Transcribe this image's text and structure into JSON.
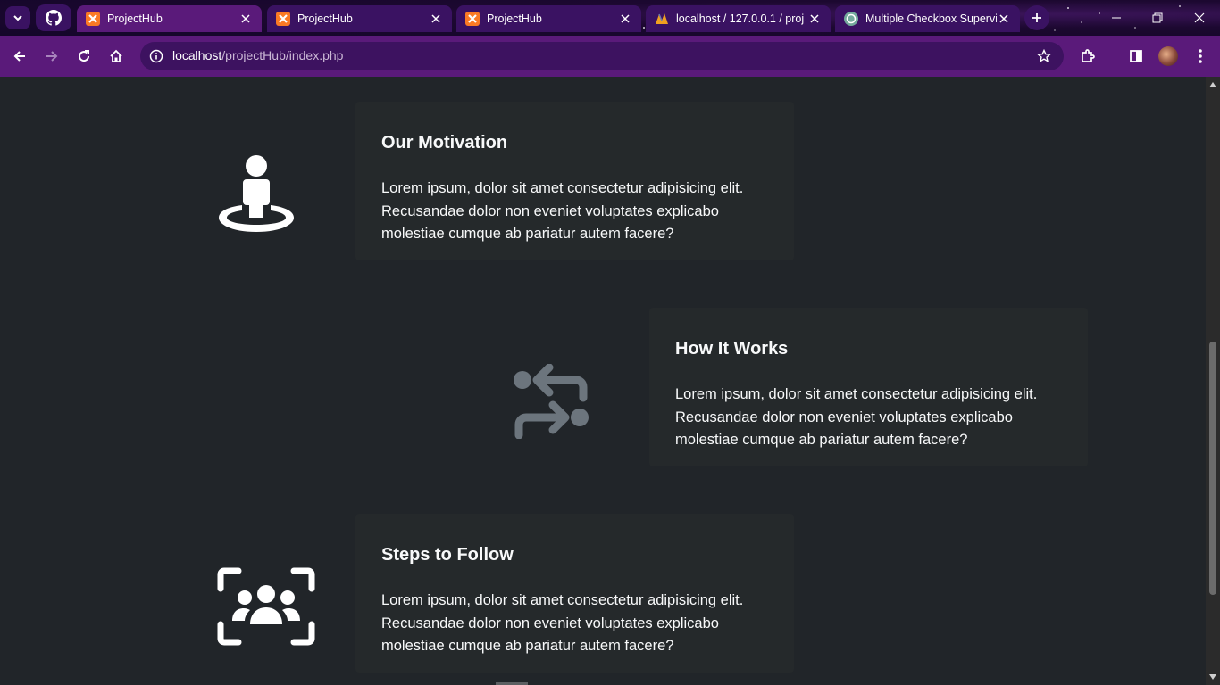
{
  "browser": {
    "tabs": [
      {
        "title": "ProjectHub",
        "favicon": "xampp-icon",
        "active": true
      },
      {
        "title": "ProjectHub",
        "favicon": "xampp-icon",
        "active": false
      },
      {
        "title": "ProjectHub",
        "favicon": "xampp-icon",
        "active": false
      },
      {
        "title": "localhost / 127.0.0.1 / proj",
        "favicon": "phpmyadmin-icon",
        "active": false
      },
      {
        "title": "Multiple Checkbox Supervi",
        "favicon": "chatgpt-icon",
        "active": false
      }
    ],
    "url_host": "localhost",
    "url_path": "/projectHub/index.php",
    "accent": "#5a1a7a"
  },
  "sections": [
    {
      "title": "Our Motivation",
      "text": "Lorem ipsum, dolor sit amet consectetur adipisicing elit. Recusandae dolor non eveniet voluptates explicabo molestiae cumque ab pariatur autem facere?",
      "icon": "person-standing-icon",
      "icon_color": "#ffffff"
    },
    {
      "title": "How It Works",
      "text": "Lorem ipsum, dolor sit amet consectetur adipisicing elit. Recusandae dolor non eveniet voluptates explicabo molestiae cumque ab pariatur autem facere?",
      "icon": "arrows-exchange-icon",
      "icon_color": "#6c757d"
    },
    {
      "title": "Steps to Follow",
      "text": "Lorem ipsum, dolor sit amet consectetur adipisicing elit. Recusandae dolor non eveniet voluptates explicabo molestiae cumque ab pariatur autem facere?",
      "icon": "group-focus-icon",
      "icon_color": "#ffffff"
    }
  ],
  "colors": {
    "page_bg": "#212529",
    "card_bg": "#25292b",
    "text": "#f8f9fa"
  }
}
